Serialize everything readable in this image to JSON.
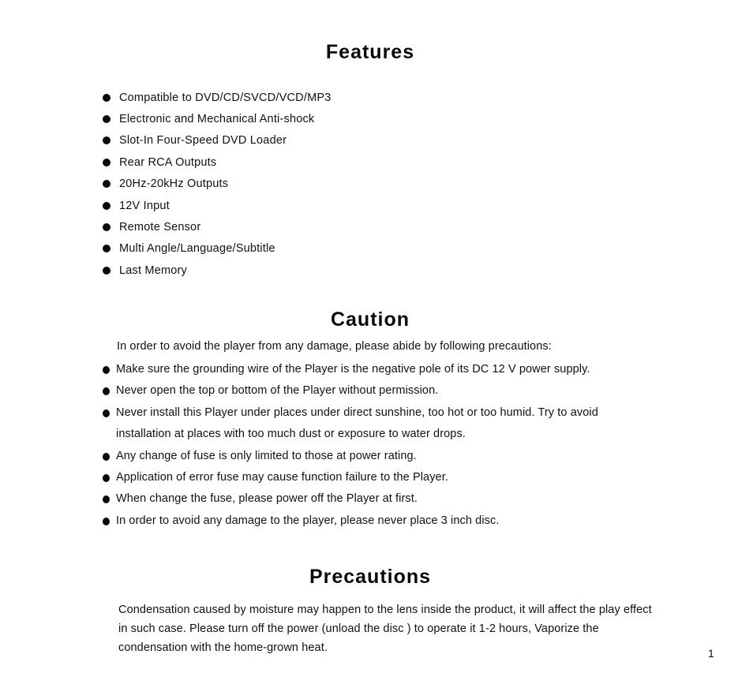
{
  "features": {
    "title": "Features",
    "items": [
      "Compatible to DVD/CD/SVCD/VCD/MP3",
      "Electronic and Mechanical Anti-shock",
      "Slot-In Four-Speed DVD Loader",
      "Rear RCA Outputs",
      "20Hz-20kHz Outputs",
      "12V Input",
      "Remote Sensor",
      "Multi Angle/Language/Subtitle",
      "Last Memory"
    ]
  },
  "caution": {
    "title": "Caution",
    "intro": "In order to avoid the player from any damage, please abide by following precautions:",
    "items": [
      "Make sure the grounding wire of the Player is the negative pole of its DC 12 V power supply.",
      "Never open the top or bottom of the Player without permission.",
      "Never install this Player under places under direct sunshine, too hot or too humid. Try to avoid installation at places with too much dust or exposure to water drops.",
      "Any change of fuse is only limited to those at power rating.",
      "Application of error fuse may cause function failure to the Player.",
      "When change the fuse, please power off the Player at first.",
      "In order to avoid any damage to the player, please never place 3 inch disc."
    ]
  },
  "precautions": {
    "title": "Precautions",
    "text": "Condensation caused by moisture may happen to the lens inside the product, it will affect the play effect in such case. Please turn off the power (unload the disc ) to operate it 1-2 hours, Vaporize the condensation with the home-grown heat."
  },
  "page_number": "1",
  "bullet_icon": "filled-circle-bullet"
}
